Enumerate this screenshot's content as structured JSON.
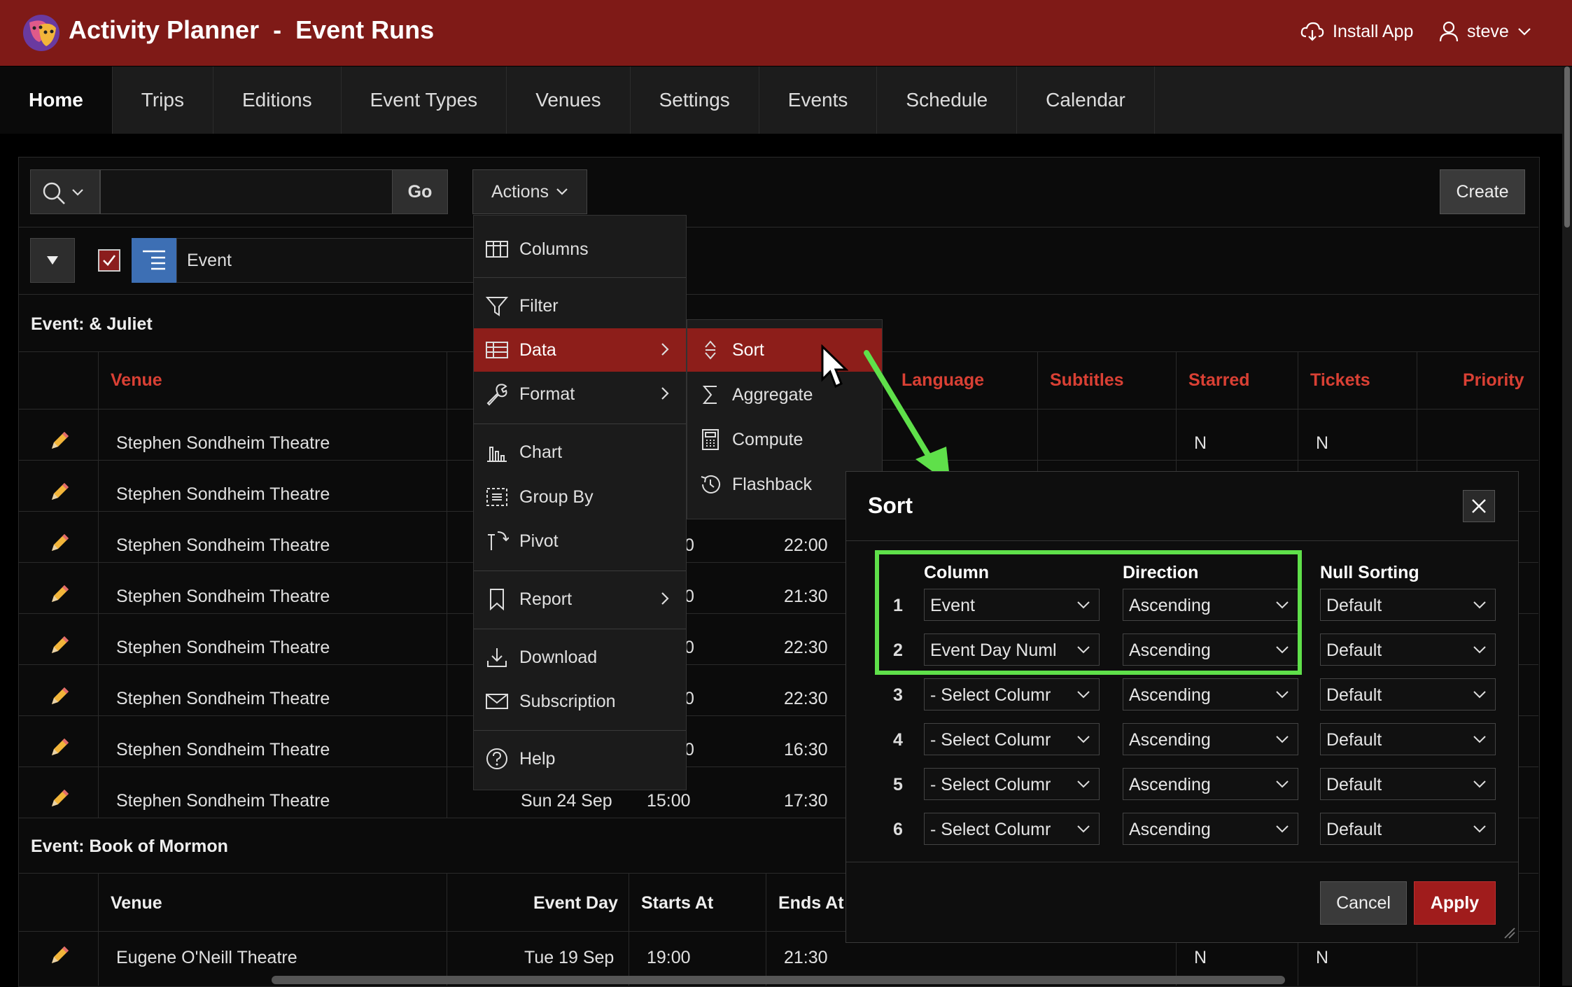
{
  "header": {
    "app_title": "Activity Planner  -  Event Runs",
    "install_label": "Install App",
    "user_label": "steve"
  },
  "nav": [
    {
      "label": "Home"
    },
    {
      "label": "Trips"
    },
    {
      "label": "Editions"
    },
    {
      "label": "Event Types"
    },
    {
      "label": "Venues"
    },
    {
      "label": "Settings"
    },
    {
      "label": "Events"
    },
    {
      "label": "Schedule"
    },
    {
      "label": "Calendar"
    }
  ],
  "toolbar": {
    "go_label": "Go",
    "actions_label": "Actions",
    "create_label": "Create"
  },
  "filter": {
    "label": "Event"
  },
  "group1": {
    "title": "Event: & Juliet",
    "headers": {
      "venue": "Venue",
      "language": "Language",
      "subtitles": "Subtitles",
      "starred": "Starred",
      "tickets": "Tickets",
      "priority": "Priority"
    },
    "rows": [
      {
        "venue": "Stephen Sondheim Theatre",
        "starts": "",
        "ends": "",
        "starred": "N",
        "tickets": "N"
      },
      {
        "venue": "Stephen Sondheim Theatre",
        "starts": "",
        "ends": ""
      },
      {
        "venue": "Stephen Sondheim Theatre",
        "starts": "0",
        "ends": "22:00"
      },
      {
        "venue": "Stephen Sondheim Theatre",
        "starts": "0",
        "ends": "21:30"
      },
      {
        "venue": "Stephen Sondheim Theatre",
        "starts": "0",
        "ends": "22:30"
      },
      {
        "venue": "Stephen Sondheim Theatre",
        "starts": "0",
        "ends": "22:30"
      },
      {
        "venue": "Stephen Sondheim Theatre",
        "starts": "0",
        "ends": "16:30"
      },
      {
        "venue": "Stephen Sondheim Theatre",
        "day": "Sun 24 Sep",
        "starts": "15:00",
        "ends": "17:30"
      }
    ]
  },
  "group2": {
    "title": "Event: Book of Mormon",
    "headers": {
      "venue": "Venue",
      "event_day": "Event Day",
      "starts_at": "Starts At",
      "ends_at": "Ends At"
    },
    "rows": [
      {
        "venue": "Eugene O'Neill Theatre",
        "day": "Tue 19 Sep",
        "starts": "19:00",
        "ends": "21:30",
        "starred": "N",
        "tickets": "N"
      }
    ]
  },
  "actions_menu": {
    "items": [
      {
        "label": "Columns",
        "icon": "columns-icon"
      },
      {
        "label": "Filter",
        "icon": "filter-icon"
      },
      {
        "label": "Data",
        "icon": "table-icon"
      },
      {
        "label": "Format",
        "icon": "wrench-icon"
      },
      {
        "label": "Chart",
        "icon": "bar-chart-icon"
      },
      {
        "label": "Group By",
        "icon": "group-by-icon"
      },
      {
        "label": "Pivot",
        "icon": "pivot-icon"
      },
      {
        "label": "Report",
        "icon": "bookmark-icon"
      },
      {
        "label": "Download",
        "icon": "download-icon"
      },
      {
        "label": "Subscription",
        "icon": "envelope-icon"
      },
      {
        "label": "Help",
        "icon": "help-icon"
      }
    ],
    "highlighted": "Data"
  },
  "data_submenu": {
    "items": [
      {
        "label": "Sort",
        "icon": "sort-icon"
      },
      {
        "label": "Aggregate",
        "icon": "sigma-icon"
      },
      {
        "label": "Compute",
        "icon": "calculator-icon"
      },
      {
        "label": "Flashback",
        "icon": "history-icon"
      }
    ],
    "highlighted": "Sort"
  },
  "sort_dialog": {
    "title": "Sort",
    "headers": {
      "column": "Column",
      "direction": "Direction",
      "null_sorting": "Null Sorting"
    },
    "rows": [
      {
        "num": "1",
        "column": "Event",
        "direction": "Ascending",
        "nulls": "Default"
      },
      {
        "num": "2",
        "column": "Event Day Numl",
        "direction": "Ascending",
        "nulls": "Default"
      },
      {
        "num": "3",
        "column": "- Select Columr",
        "direction": "Ascending",
        "nulls": "Default"
      },
      {
        "num": "4",
        "column": "- Select Columr",
        "direction": "Ascending",
        "nulls": "Default"
      },
      {
        "num": "5",
        "column": "- Select Columr",
        "direction": "Ascending",
        "nulls": "Default"
      },
      {
        "num": "6",
        "column": "- Select Columr",
        "direction": "Ascending",
        "nulls": "Default"
      }
    ],
    "cancel_label": "Cancel",
    "apply_label": "Apply"
  },
  "colors": {
    "brand": "#7f1a17",
    "menu_highlight": "#8d1e1a",
    "annotation": "#5fe04a",
    "header_red": "#d94034"
  }
}
